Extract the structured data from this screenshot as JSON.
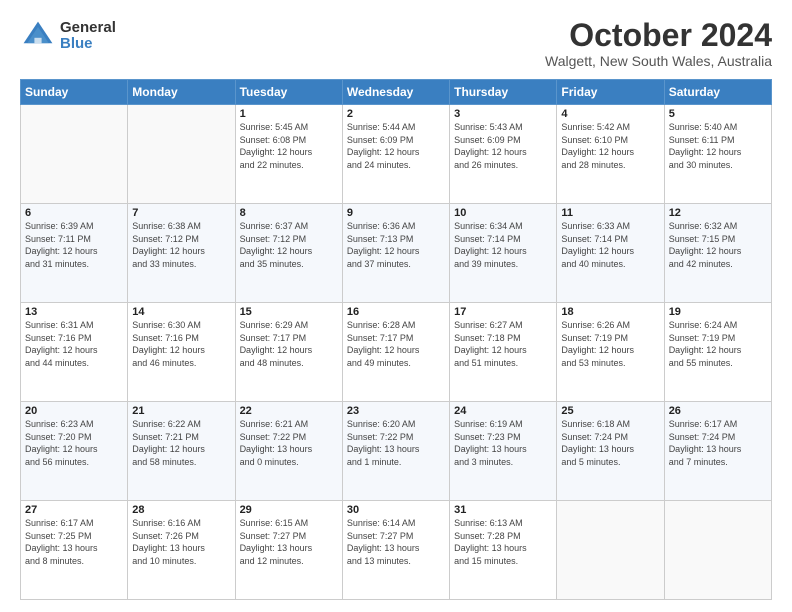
{
  "header": {
    "logo": {
      "general": "General",
      "blue": "Blue"
    },
    "title": "October 2024",
    "location": "Walgett, New South Wales, Australia"
  },
  "weekdays": [
    "Sunday",
    "Monday",
    "Tuesday",
    "Wednesday",
    "Thursday",
    "Friday",
    "Saturday"
  ],
  "weeks": [
    [
      {
        "day": "",
        "info": ""
      },
      {
        "day": "",
        "info": ""
      },
      {
        "day": "1",
        "info": "Sunrise: 5:45 AM\nSunset: 6:08 PM\nDaylight: 12 hours\nand 22 minutes."
      },
      {
        "day": "2",
        "info": "Sunrise: 5:44 AM\nSunset: 6:09 PM\nDaylight: 12 hours\nand 24 minutes."
      },
      {
        "day": "3",
        "info": "Sunrise: 5:43 AM\nSunset: 6:09 PM\nDaylight: 12 hours\nand 26 minutes."
      },
      {
        "day": "4",
        "info": "Sunrise: 5:42 AM\nSunset: 6:10 PM\nDaylight: 12 hours\nand 28 minutes."
      },
      {
        "day": "5",
        "info": "Sunrise: 5:40 AM\nSunset: 6:11 PM\nDaylight: 12 hours\nand 30 minutes."
      }
    ],
    [
      {
        "day": "6",
        "info": "Sunrise: 6:39 AM\nSunset: 7:11 PM\nDaylight: 12 hours\nand 31 minutes."
      },
      {
        "day": "7",
        "info": "Sunrise: 6:38 AM\nSunset: 7:12 PM\nDaylight: 12 hours\nand 33 minutes."
      },
      {
        "day": "8",
        "info": "Sunrise: 6:37 AM\nSunset: 7:12 PM\nDaylight: 12 hours\nand 35 minutes."
      },
      {
        "day": "9",
        "info": "Sunrise: 6:36 AM\nSunset: 7:13 PM\nDaylight: 12 hours\nand 37 minutes."
      },
      {
        "day": "10",
        "info": "Sunrise: 6:34 AM\nSunset: 7:14 PM\nDaylight: 12 hours\nand 39 minutes."
      },
      {
        "day": "11",
        "info": "Sunrise: 6:33 AM\nSunset: 7:14 PM\nDaylight: 12 hours\nand 40 minutes."
      },
      {
        "day": "12",
        "info": "Sunrise: 6:32 AM\nSunset: 7:15 PM\nDaylight: 12 hours\nand 42 minutes."
      }
    ],
    [
      {
        "day": "13",
        "info": "Sunrise: 6:31 AM\nSunset: 7:16 PM\nDaylight: 12 hours\nand 44 minutes."
      },
      {
        "day": "14",
        "info": "Sunrise: 6:30 AM\nSunset: 7:16 PM\nDaylight: 12 hours\nand 46 minutes."
      },
      {
        "day": "15",
        "info": "Sunrise: 6:29 AM\nSunset: 7:17 PM\nDaylight: 12 hours\nand 48 minutes."
      },
      {
        "day": "16",
        "info": "Sunrise: 6:28 AM\nSunset: 7:17 PM\nDaylight: 12 hours\nand 49 minutes."
      },
      {
        "day": "17",
        "info": "Sunrise: 6:27 AM\nSunset: 7:18 PM\nDaylight: 12 hours\nand 51 minutes."
      },
      {
        "day": "18",
        "info": "Sunrise: 6:26 AM\nSunset: 7:19 PM\nDaylight: 12 hours\nand 53 minutes."
      },
      {
        "day": "19",
        "info": "Sunrise: 6:24 AM\nSunset: 7:19 PM\nDaylight: 12 hours\nand 55 minutes."
      }
    ],
    [
      {
        "day": "20",
        "info": "Sunrise: 6:23 AM\nSunset: 7:20 PM\nDaylight: 12 hours\nand 56 minutes."
      },
      {
        "day": "21",
        "info": "Sunrise: 6:22 AM\nSunset: 7:21 PM\nDaylight: 12 hours\nand 58 minutes."
      },
      {
        "day": "22",
        "info": "Sunrise: 6:21 AM\nSunset: 7:22 PM\nDaylight: 13 hours\nand 0 minutes."
      },
      {
        "day": "23",
        "info": "Sunrise: 6:20 AM\nSunset: 7:22 PM\nDaylight: 13 hours\nand 1 minute."
      },
      {
        "day": "24",
        "info": "Sunrise: 6:19 AM\nSunset: 7:23 PM\nDaylight: 13 hours\nand 3 minutes."
      },
      {
        "day": "25",
        "info": "Sunrise: 6:18 AM\nSunset: 7:24 PM\nDaylight: 13 hours\nand 5 minutes."
      },
      {
        "day": "26",
        "info": "Sunrise: 6:17 AM\nSunset: 7:24 PM\nDaylight: 13 hours\nand 7 minutes."
      }
    ],
    [
      {
        "day": "27",
        "info": "Sunrise: 6:17 AM\nSunset: 7:25 PM\nDaylight: 13 hours\nand 8 minutes."
      },
      {
        "day": "28",
        "info": "Sunrise: 6:16 AM\nSunset: 7:26 PM\nDaylight: 13 hours\nand 10 minutes."
      },
      {
        "day": "29",
        "info": "Sunrise: 6:15 AM\nSunset: 7:27 PM\nDaylight: 13 hours\nand 12 minutes."
      },
      {
        "day": "30",
        "info": "Sunrise: 6:14 AM\nSunset: 7:27 PM\nDaylight: 13 hours\nand 13 minutes."
      },
      {
        "day": "31",
        "info": "Sunrise: 6:13 AM\nSunset: 7:28 PM\nDaylight: 13 hours\nand 15 minutes."
      },
      {
        "day": "",
        "info": ""
      },
      {
        "day": "",
        "info": ""
      }
    ]
  ]
}
